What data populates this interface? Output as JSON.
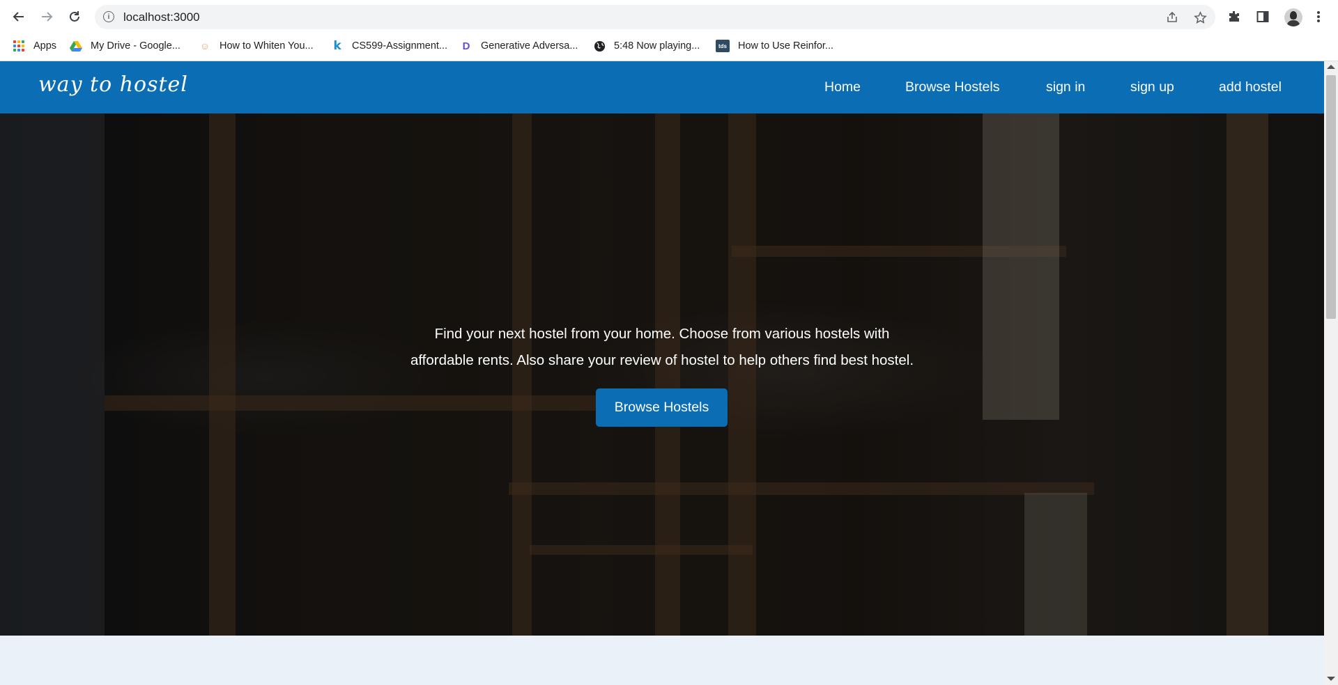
{
  "browser": {
    "url": "localhost:3000",
    "toolbar_icons": [
      "back-arrow-icon",
      "forward-arrow-icon",
      "reload-icon",
      "info-icon",
      "share-icon",
      "star-icon",
      "extensions-icon",
      "side-panel-icon",
      "profile-avatar",
      "more-menu-icon"
    ],
    "bookmarks": [
      {
        "label": "Apps",
        "icon": "apps-grid-icon"
      },
      {
        "label": "My Drive - Google...",
        "icon": "google-drive-icon"
      },
      {
        "label": "How to Whiten You...",
        "icon": "site-favicon"
      },
      {
        "label": "CS599-Assignment...",
        "icon": "k-favicon"
      },
      {
        "label": "Generative Adversa...",
        "icon": "dd-favicon"
      },
      {
        "label": "5:48 Now playing...",
        "icon": "globe-icon"
      },
      {
        "label": "How to Use Reinfor...",
        "icon": "tds-favicon",
        "icon_text": "tds"
      }
    ]
  },
  "site": {
    "brand": "way to hostel",
    "nav": [
      "Home",
      "Browse Hostels",
      "sign in",
      "sign up",
      "add hostel"
    ],
    "hero": {
      "line1": "Find your next hostel from your home. Choose from various hostels with",
      "line2": "affordable rents. Also share your review of hostel to help others find best hostel.",
      "button": "Browse Hostels"
    }
  },
  "colors": {
    "navbar": "#0b6db4",
    "button": "#0b6db4",
    "page_bg": "#eaf1f8"
  }
}
